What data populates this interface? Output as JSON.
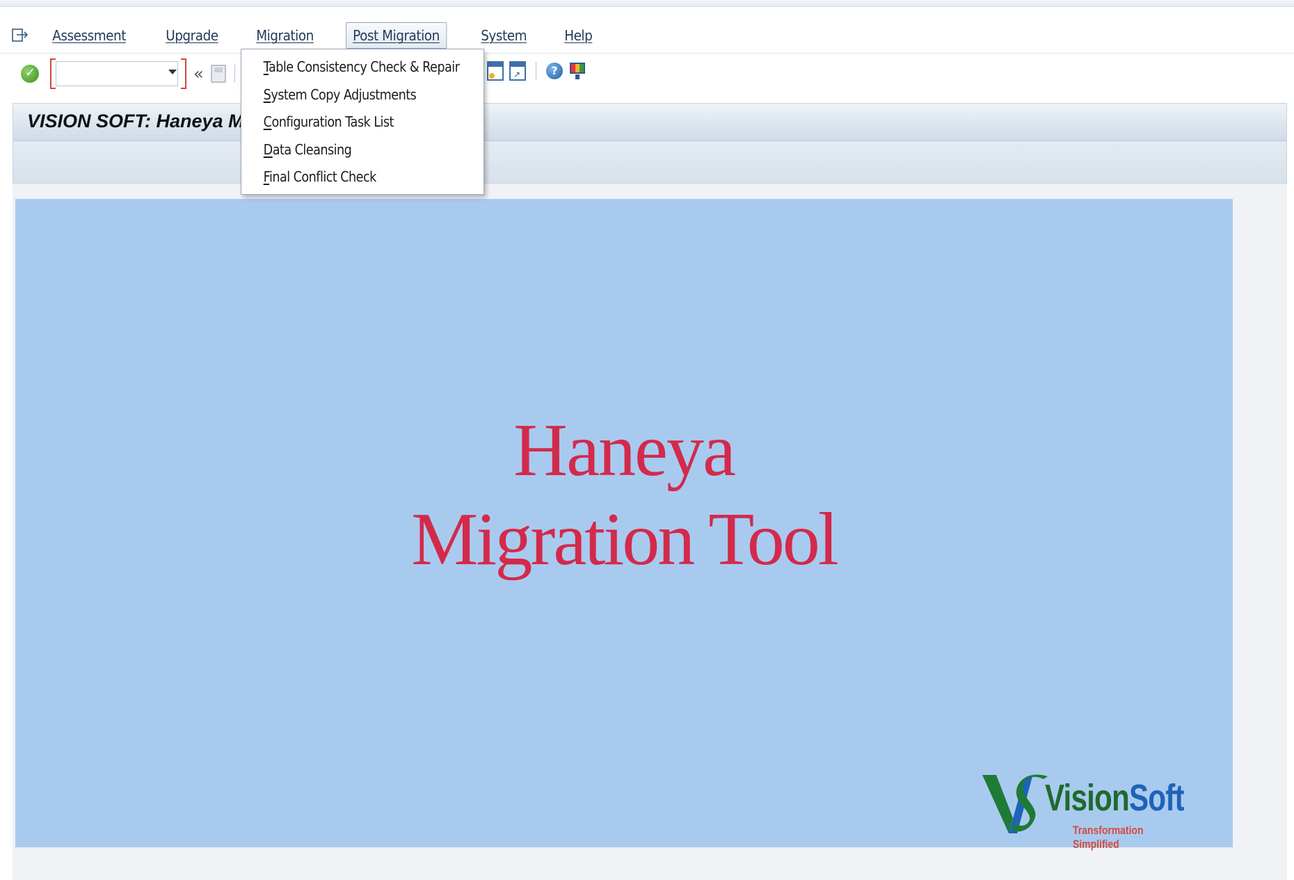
{
  "menubar": {
    "items": [
      {
        "label": "Assessment",
        "accel": "A",
        "rest": "ssessment"
      },
      {
        "label": "Upgrade",
        "accel": "U",
        "rest": "pgrade"
      },
      {
        "label": "Migration",
        "accel": "M",
        "rest": "igration"
      },
      {
        "label": "Post Migration",
        "accel": "P",
        "rest": "ost Migration"
      },
      {
        "label": "System",
        "accel": "y",
        "rest": "stem"
      },
      {
        "label": "Help",
        "accel": "H",
        "rest": "elp"
      }
    ],
    "active": "Post Migration"
  },
  "toolbar": {
    "command_field_value": "",
    "chevrons": "«",
    "help_symbol": "?"
  },
  "dropdown": {
    "items": [
      {
        "accel": "T",
        "rest": "able Consistency Check & Repair"
      },
      {
        "accel": "S",
        "rest": "ystem Copy Adjustments"
      },
      {
        "accel": "C",
        "rest": "onfiguration Task List"
      },
      {
        "accel": "D",
        "rest": "ata Cleansing"
      },
      {
        "accel": "F",
        "rest": "inal Conflict Check"
      }
    ]
  },
  "title": "VISION SOFT: Haneya Mig",
  "splash": {
    "line1": "Haneya",
    "line2": "Migration Tool"
  },
  "logo": {
    "name_part1": "Vision",
    "name_part2": "Soft",
    "tagline": "Transformation Simplified"
  },
  "colors": {
    "splash_background": "#a9caef",
    "splash_text": "#d32a4b",
    "logo_green": "#1f6a2f",
    "logo_blue": "#1f63b8",
    "logo_tagline": "#d84a3b"
  }
}
